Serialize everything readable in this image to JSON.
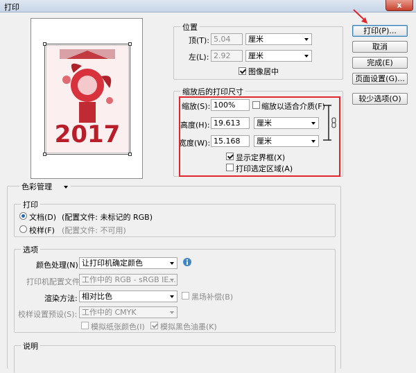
{
  "window": {
    "title": "打印",
    "close_label": "x"
  },
  "buttons": {
    "print": "打印(P)...",
    "cancel": "取消",
    "done": "完成(E)",
    "page_setup": "页面设置(G)...",
    "fewer_options": "较少选项(O)"
  },
  "position": {
    "group_title": "位置",
    "top_label": "顶(T):",
    "top_value": "5.04",
    "top_unit": "厘米",
    "left_label": "左(L):",
    "left_value": "2.92",
    "left_unit": "厘米",
    "center_label": "图像居中",
    "center_checked": true
  },
  "scaled": {
    "group_title": "缩放后的打印尺寸",
    "scale_label": "缩放(S):",
    "scale_value": "100%",
    "fit_label": "缩放以适合介质(F)",
    "height_label": "高度(H):",
    "height_value": "19.613",
    "height_unit": "厘米",
    "width_label": "宽度(W):",
    "width_value": "15.168",
    "width_unit": "厘米",
    "bbox_label": "显示定界框(X)",
    "bbox_checked": true,
    "selection_label": "打印选定区域(A)",
    "selection_checked": false
  },
  "color_mgmt": {
    "dropdown": "色彩管理"
  },
  "print_group": {
    "title": "打印",
    "document_label": "文档(D)",
    "document_profile": "(配置文件: 未标记的 RGB)",
    "proof_label": "校样(F)",
    "proof_profile": "(配置文件: 不可用)"
  },
  "options": {
    "title": "选项",
    "color_handling_label": "颜色处理(N):",
    "color_handling_value": "让打印机确定颜色",
    "printer_profile_label": "打印机配置文件:",
    "printer_profile_value": "工作中的 RGB - sRGB IE...",
    "rendering_label": "渲染方法:",
    "rendering_value": "相对比色",
    "black_point_label": "黑场补偿(B)",
    "proof_setup_label": "校样设置预设(S):",
    "proof_setup_value": "工作中的 CMYK",
    "simulate_paper_label": "模拟纸张颜色(I)",
    "simulate_black_label": "模拟黑色油墨(K)"
  },
  "description": {
    "title": "说明"
  },
  "preview": {
    "year_text": "2017"
  },
  "icons": {
    "info": "info-icon",
    "link": "chain-link-icon"
  },
  "colors": {
    "highlight": "#e0262a",
    "accent": "#1d6bb5",
    "arrow": "#e0262a"
  }
}
